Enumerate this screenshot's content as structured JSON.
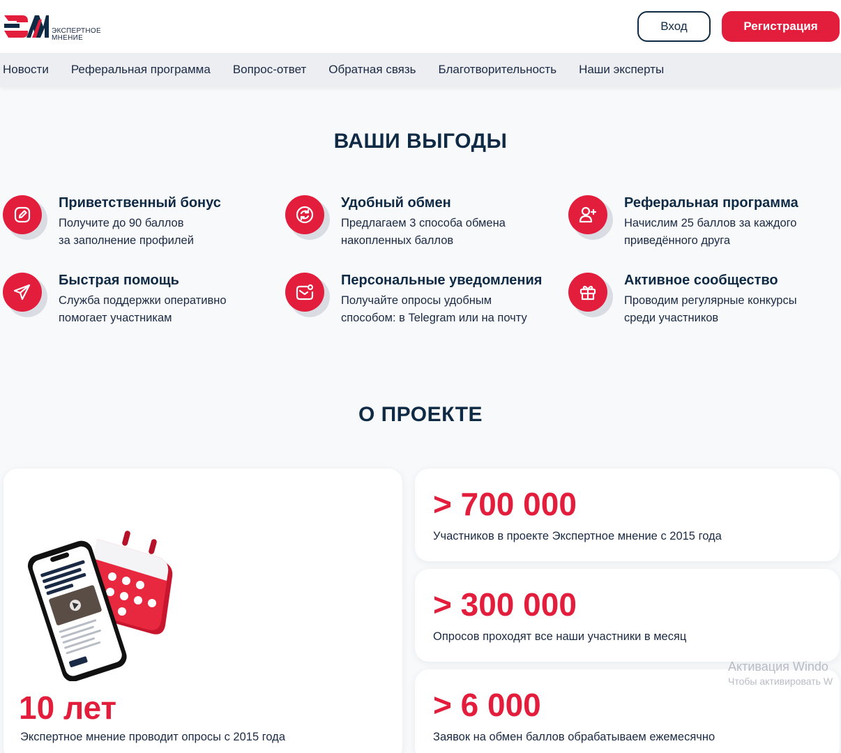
{
  "header": {
    "logo_text_line1": "ЭКСПЕРТНОЕ",
    "logo_text_line2": "МНЕНИЕ",
    "login_label": "Вход",
    "register_label": "Регистрация"
  },
  "nav": {
    "items": [
      "Новости",
      "Реферальная программа",
      "Вопрос-ответ",
      "Обратная связь",
      "Благотворительность",
      "Наши эксперты"
    ]
  },
  "benefits": {
    "title": "ВАШИ ВЫГОДЫ",
    "items": [
      {
        "icon": "edit-icon",
        "title": "Приветственный бонус",
        "line1": "Получите до 90 баллов",
        "line2": "за заполнение профилей"
      },
      {
        "icon": "exchange-icon",
        "title": "Удобный обмен",
        "line1": "Предлагаем 3 способа обмена",
        "line2": "накопленных баллов"
      },
      {
        "icon": "user-plus-icon",
        "title": "Реферальная программа",
        "line1": "Начислим 25 баллов за каждого",
        "line2": "приведённого друга"
      },
      {
        "icon": "send-icon",
        "title": "Быстрая помощь",
        "line1": "Служба поддержки оперативно",
        "line2": "помогает участникам"
      },
      {
        "icon": "mail-notification-icon",
        "title": "Персональные уведомления",
        "line1": "Получайте опросы удобным",
        "line2": "способом: в Telegram или на почту"
      },
      {
        "icon": "gift-icon",
        "title": "Активное сообщество",
        "line1": "Проводим регулярные конкурсы",
        "line2": "среди участников"
      }
    ]
  },
  "about": {
    "title": "О ПРОЕКТЕ",
    "years": {
      "value": "10 лет",
      "text": "Экспертное мнение проводит опросы с 2015 года"
    },
    "stats": [
      {
        "value": "> 700 000",
        "text": "Участников в проекте Экспертное мнение с 2015 года"
      },
      {
        "value": "> 300 000",
        "text": "Опросов проходят все наши участники в месяц"
      },
      {
        "value": "> 6 000",
        "text": "Заявок на обмен баллов обрабатываем ежемесячно"
      }
    ]
  },
  "watermark": {
    "line1": "Активация Windo",
    "line2": "Чтобы активировать W"
  },
  "colors": {
    "accent": "#e31e3c",
    "dark": "#0f2a44",
    "background": "#f8f9fb"
  }
}
